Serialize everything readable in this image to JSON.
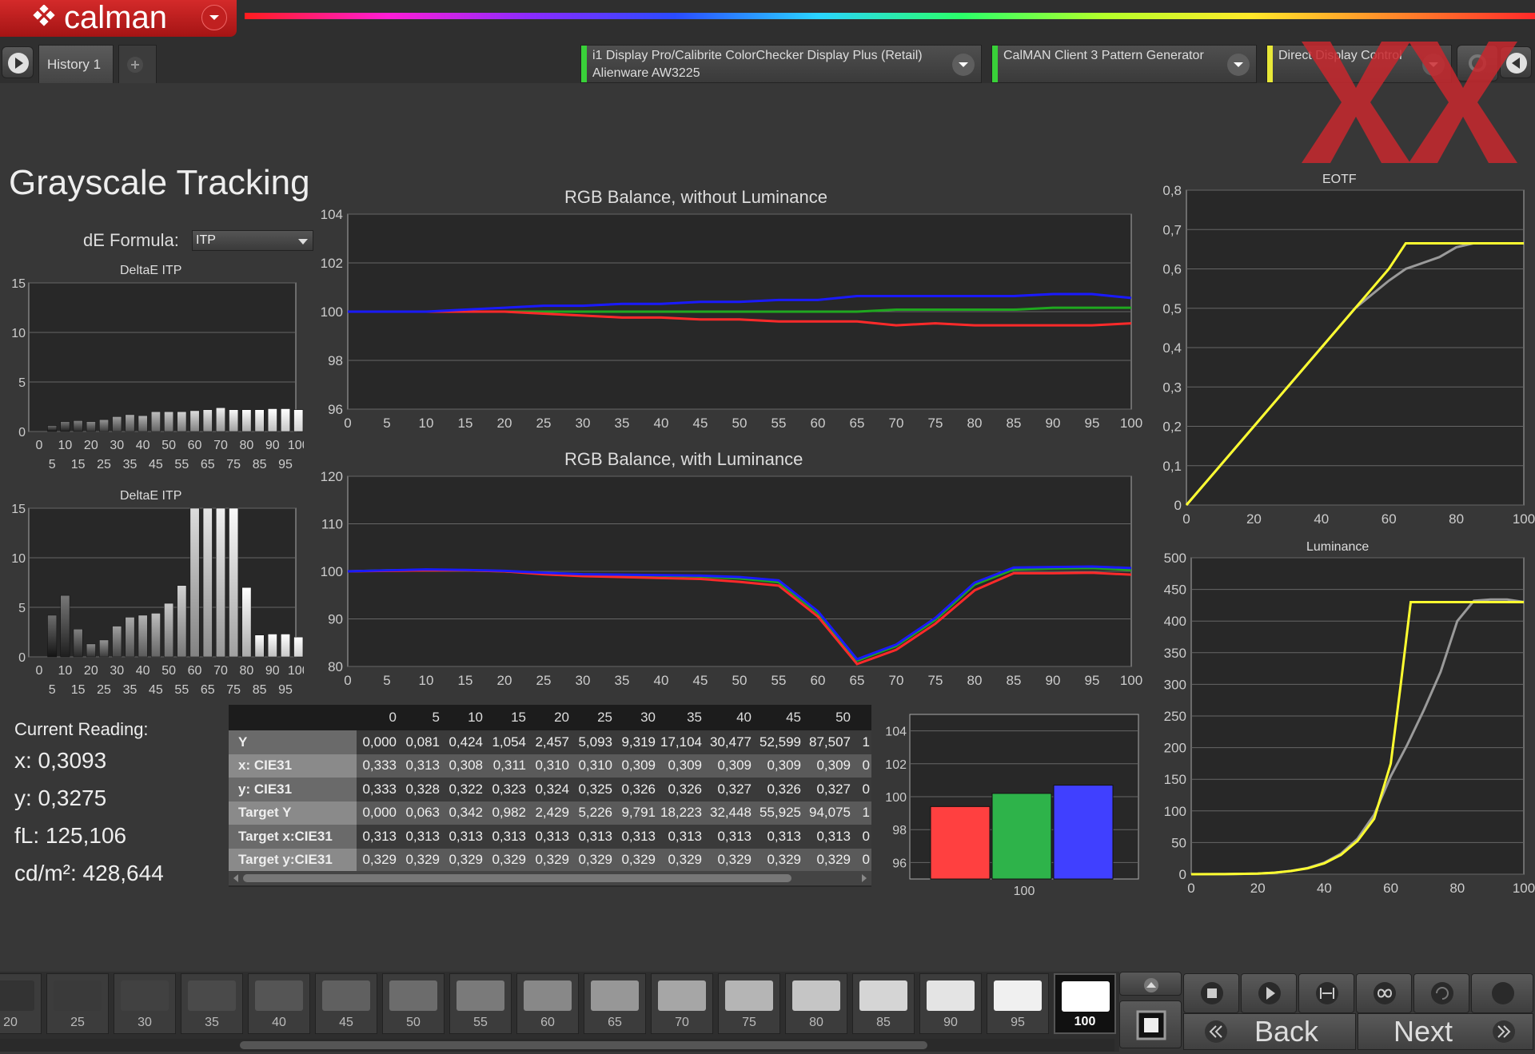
{
  "app": {
    "logo_text": "calman"
  },
  "header": {
    "history_tab": "History 1",
    "add_tab": "+",
    "meter": {
      "line1": "i1 Display Pro/Calibrite ColorChecker Display Plus (Retail)",
      "line2": "Alienware AW3225",
      "color": "#39d139"
    },
    "generator": {
      "line1": "CalMAN Client 3 Pattern Generator",
      "color": "#39d139"
    },
    "display_control": {
      "line1": "Direct Display Control",
      "color": "#e8e838"
    }
  },
  "page": {
    "title": "Grayscale Tracking",
    "de_formula_label": "dE Formula:",
    "de_formula_value": "ITP"
  },
  "reading": {
    "label": "Current Reading:",
    "x": "x: 0,3093",
    "y": "y: 0,3275",
    "fl": "fL: 125,106",
    "cdm2": "cd/m²: 428,644"
  },
  "colors": {
    "red": "#ff2a2a",
    "green": "#1fa81f",
    "blue": "#1a1aff",
    "yellow": "#ffff30",
    "gray": "#9a9a9a"
  },
  "charts": {
    "deltaE_top": {
      "title": "DeltaE ITP",
      "yticks": [
        "15",
        "10",
        "5",
        "0"
      ],
      "ylim": [
        0,
        15
      ],
      "xticks_a": [
        "0",
        "10",
        "20",
        "30",
        "40",
        "50",
        "60",
        "70",
        "80",
        "90",
        "100"
      ],
      "xticks_b": [
        "5",
        "15",
        "25",
        "35",
        "45",
        "55",
        "65",
        "75",
        "85",
        "95"
      ],
      "values": [
        0,
        0.6,
        1.0,
        1.1,
        1.0,
        1.2,
        1.5,
        1.7,
        1.6,
        2.0,
        2.0,
        2.0,
        2.1,
        2.2,
        2.4,
        2.2,
        2.2,
        2.2,
        2.3,
        2.3,
        2.2
      ]
    },
    "deltaE_bottom": {
      "title": "DeltaE ITP",
      "yticks": [
        "15",
        "10",
        "5",
        "0"
      ],
      "ylim": [
        0,
        15
      ],
      "xticks_a": [
        "0",
        "10",
        "20",
        "30",
        "40",
        "50",
        "60",
        "70",
        "80",
        "90",
        "100"
      ],
      "xticks_b": [
        "5",
        "15",
        "25",
        "35",
        "45",
        "55",
        "65",
        "75",
        "85",
        "95"
      ],
      "values": [
        0,
        4.2,
        6.2,
        2.8,
        1.3,
        1.7,
        3.1,
        4.0,
        4.2,
        4.4,
        5.4,
        7.2,
        15,
        15,
        15,
        15,
        7.0,
        2.2,
        2.3,
        2.3,
        2.0
      ]
    },
    "rgb_no_lum": {
      "title": "RGB Balance, without Luminance",
      "ylim": [
        95,
        105
      ],
      "yticks": [
        "104",
        "102",
        "100",
        "98",
        "96"
      ],
      "xticks": [
        "0",
        "5",
        "10",
        "15",
        "20",
        "25",
        "30",
        "35",
        "40",
        "45",
        "50",
        "55",
        "60",
        "65",
        "70",
        "75",
        "80",
        "85",
        "90",
        "95",
        "100"
      ],
      "red": [
        100,
        100,
        100,
        100,
        100,
        99.9,
        99.8,
        99.7,
        99.7,
        99.6,
        99.6,
        99.5,
        99.5,
        99.5,
        99.3,
        99.4,
        99.3,
        99.3,
        99.3,
        99.3,
        99.4
      ],
      "green": [
        100,
        100,
        100,
        100,
        100,
        100,
        100,
        100,
        100,
        100,
        100,
        100,
        100,
        100,
        100.1,
        100.1,
        100.1,
        100.1,
        100.2,
        100.2,
        100.2
      ],
      "blue": [
        100,
        100,
        100,
        100.1,
        100.2,
        100.3,
        100.3,
        100.4,
        100.4,
        100.5,
        100.5,
        100.6,
        100.6,
        100.8,
        100.8,
        100.8,
        100.8,
        100.8,
        100.9,
        100.9,
        100.7
      ]
    },
    "rgb_lum": {
      "title": "RGB Balance, with Luminance",
      "ylim": [
        80,
        120
      ],
      "yticks": [
        "120",
        "110",
        "100",
        "90",
        "80"
      ],
      "xticks": [
        "0",
        "5",
        "10",
        "15",
        "20",
        "25",
        "30",
        "35",
        "40",
        "45",
        "50",
        "55",
        "60",
        "65",
        "70",
        "75",
        "80",
        "85",
        "90",
        "95",
        "100"
      ],
      "red": [
        100,
        100.1,
        100.2,
        100.2,
        100,
        99.4,
        99,
        98.8,
        98.6,
        98.4,
        97.8,
        97,
        90.5,
        80.5,
        83.5,
        89,
        96,
        99.6,
        99.6,
        99.7,
        99.3
      ],
      "green": [
        100,
        100.2,
        100.3,
        100.2,
        100,
        99.6,
        99.3,
        99.2,
        99.1,
        98.9,
        98.5,
        97.7,
        91.2,
        81.2,
        84.3,
        89.8,
        97.2,
        100.4,
        100.6,
        100.7,
        100.3
      ],
      "blue": [
        100,
        100.2,
        100.4,
        100.3,
        100.1,
        99.7,
        99.4,
        99.3,
        99.2,
        99.1,
        98.8,
        98.1,
        91.6,
        81.5,
        84.6,
        90.2,
        97.6,
        100.8,
        100.9,
        101,
        100.7
      ]
    },
    "eotf": {
      "title": "EOTF",
      "ylim": [
        0,
        0.8
      ],
      "xlim": [
        0,
        100
      ],
      "yticks": [
        "0,8",
        "0,7",
        "0,6",
        "0,5",
        "0,4",
        "0,3",
        "0,2",
        "0,1",
        "0"
      ],
      "xticks": [
        "0",
        "20",
        "40",
        "60",
        "80",
        "100"
      ],
      "target_x": [
        0,
        10,
        20,
        30,
        40,
        50,
        60,
        65,
        70,
        75,
        80,
        85,
        90,
        95,
        100
      ],
      "target_y": [
        0,
        0.1,
        0.2,
        0.3,
        0.4,
        0.5,
        0.57,
        0.6,
        0.615,
        0.63,
        0.655,
        0.665,
        0.665,
        0.665,
        0.665
      ],
      "measured_x": [
        0,
        10,
        20,
        30,
        40,
        50,
        60,
        65,
        70,
        75,
        80,
        85,
        90,
        95,
        100
      ],
      "measured_y": [
        0,
        0.1,
        0.2,
        0.3,
        0.4,
        0.5,
        0.6,
        0.665,
        0.665,
        0.665,
        0.665,
        0.665,
        0.665,
        0.665,
        0.665
      ]
    },
    "luminance": {
      "title": "Luminance",
      "ylim": [
        0,
        500
      ],
      "xlim": [
        0,
        100
      ],
      "yticks": [
        "500",
        "450",
        "400",
        "350",
        "300",
        "250",
        "200",
        "150",
        "100",
        "50",
        "0"
      ],
      "xticks": [
        "0",
        "20",
        "40",
        "60",
        "80",
        "100"
      ],
      "target_x": [
        0,
        10,
        20,
        25,
        30,
        35,
        40,
        45,
        50,
        55,
        60,
        65,
        70,
        75,
        80,
        85,
        90,
        95,
        100
      ],
      "target_y": [
        0,
        0.1,
        0.9,
        2.4,
        5.2,
        9.8,
        18.2,
        32.4,
        56,
        94,
        155,
        205,
        260,
        320,
        400,
        432,
        434,
        434,
        430
      ],
      "measured_x": [
        0,
        10,
        20,
        25,
        30,
        35,
        40,
        45,
        50,
        55,
        60,
        63,
        66,
        70,
        75,
        80,
        85,
        90,
        95,
        100
      ],
      "measured_y": [
        0,
        0.1,
        0.9,
        2.4,
        5.1,
        9.3,
        17.1,
        30.5,
        52.6,
        87.5,
        175,
        300,
        430,
        430,
        430,
        430,
        430,
        430,
        430,
        430
      ]
    },
    "bars": {
      "ylim": [
        95,
        105
      ],
      "yticks": [
        "104",
        "102",
        "100",
        "98",
        "96"
      ],
      "xlabel": "100",
      "values": [
        99.4,
        100.2,
        100.7
      ]
    }
  },
  "table": {
    "columns": [
      "",
      "0",
      "5",
      "10",
      "15",
      "20",
      "25",
      "30",
      "35",
      "40",
      "45",
      "50",
      ""
    ],
    "rows": [
      {
        "label": "Y",
        "cells": [
          "0,000",
          "0,081",
          "0,424",
          "1,054",
          "2,457",
          "5,093",
          "9,319",
          "17,104",
          "30,477",
          "52,599",
          "87,507",
          "1"
        ]
      },
      {
        "label": "x: CIE31",
        "cells": [
          "0,333",
          "0,313",
          "0,308",
          "0,311",
          "0,310",
          "0,310",
          "0,309",
          "0,309",
          "0,309",
          "0,309",
          "0,309",
          "0"
        ]
      },
      {
        "label": "y: CIE31",
        "cells": [
          "0,333",
          "0,328",
          "0,322",
          "0,323",
          "0,324",
          "0,325",
          "0,326",
          "0,326",
          "0,327",
          "0,326",
          "0,327",
          "0"
        ]
      },
      {
        "label": "Target Y",
        "cells": [
          "0,000",
          "0,063",
          "0,342",
          "0,982",
          "2,429",
          "5,226",
          "9,791",
          "18,223",
          "32,448",
          "55,925",
          "94,075",
          "1"
        ]
      },
      {
        "label": "Target x:CIE31",
        "cells": [
          "0,313",
          "0,313",
          "0,313",
          "0,313",
          "0,313",
          "0,313",
          "0,313",
          "0,313",
          "0,313",
          "0,313",
          "0,313",
          "0"
        ]
      },
      {
        "label": "Target y:CIE31",
        "cells": [
          "0,329",
          "0,329",
          "0,329",
          "0,329",
          "0,329",
          "0,329",
          "0,329",
          "0,329",
          "0,329",
          "0,329",
          "0,329",
          "0"
        ]
      }
    ]
  },
  "swatches": [
    {
      "label": "20",
      "gray": "#333"
    },
    {
      "label": "25",
      "gray": "#3a3a3a"
    },
    {
      "label": "30",
      "gray": "#414141"
    },
    {
      "label": "35",
      "gray": "#4a4a4a"
    },
    {
      "label": "40",
      "gray": "#555"
    },
    {
      "label": "45",
      "gray": "#606060"
    },
    {
      "label": "50",
      "gray": "#6c6c6c"
    },
    {
      "label": "55",
      "gray": "#7a7a7a"
    },
    {
      "label": "60",
      "gray": "#888"
    },
    {
      "label": "65",
      "gray": "#979797"
    },
    {
      "label": "70",
      "gray": "#a6a6a6"
    },
    {
      "label": "75",
      "gray": "#b5b5b5"
    },
    {
      "label": "80",
      "gray": "#c5c5c5"
    },
    {
      "label": "85",
      "gray": "#d5d5d5"
    },
    {
      "label": "90",
      "gray": "#e4e4e4"
    },
    {
      "label": "95",
      "gray": "#f0f0f0"
    },
    {
      "label": "100",
      "gray": "#ffffff",
      "selected": true
    }
  ],
  "controls": {
    "back": "Back",
    "next": "Next"
  }
}
